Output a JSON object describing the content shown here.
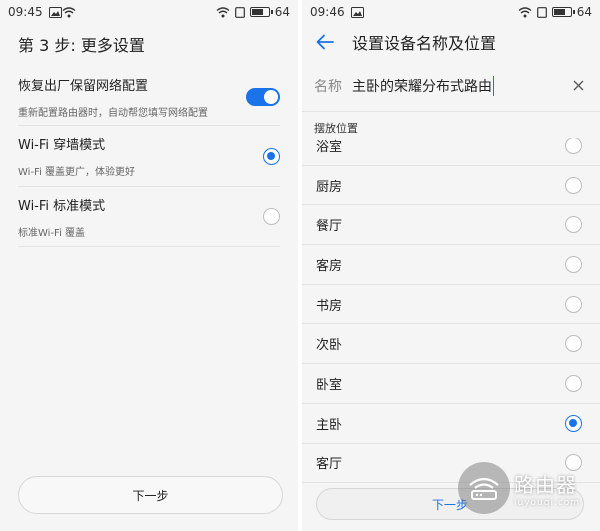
{
  "left": {
    "status": {
      "time": "09:45",
      "battery": "64"
    },
    "title": "第 3 步: 更多设置",
    "settings": [
      {
        "label": "恢复出厂保留网络配置",
        "desc": "重新配置路由器时，自动帮您填写网络配置",
        "control": "toggle",
        "on": true
      },
      {
        "label": "Wi-Fi 穿墙模式",
        "desc": "Wi-Fi 覆盖更广，体验更好",
        "control": "radio",
        "checked": true
      },
      {
        "label": "Wi-Fi 标准模式",
        "desc": "标准Wi-Fi 覆盖",
        "control": "radio",
        "checked": false
      }
    ],
    "next_label": "下一步"
  },
  "right": {
    "status": {
      "time": "09:46",
      "battery": "64"
    },
    "title": "设置设备名称及位置",
    "name_label": "名称",
    "name_value": "主卧的荣耀分布式路由",
    "section_label": "摆放位置",
    "locations": [
      {
        "label": "浴室",
        "checked": false
      },
      {
        "label": "厨房",
        "checked": false
      },
      {
        "label": "餐厅",
        "checked": false
      },
      {
        "label": "客房",
        "checked": false
      },
      {
        "label": "书房",
        "checked": false
      },
      {
        "label": "次卧",
        "checked": false
      },
      {
        "label": "卧室",
        "checked": false
      },
      {
        "label": "主卧",
        "checked": true
      },
      {
        "label": "客厅",
        "checked": false
      }
    ],
    "next_label": "下一步"
  },
  "watermark": {
    "text": "路由器",
    "subtext": "luyouqi.com"
  },
  "colors": {
    "accent": "#1a73e8",
    "background": "#f5f5f5",
    "divider": "#e3e3e3"
  }
}
